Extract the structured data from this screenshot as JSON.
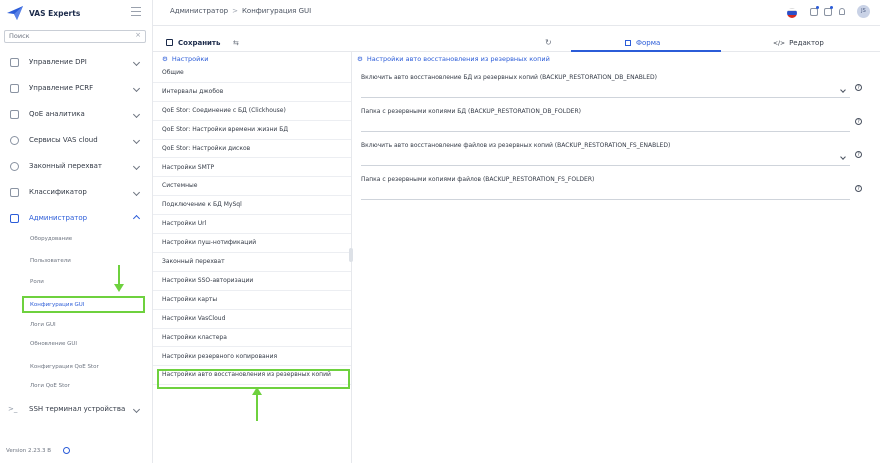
{
  "app": {
    "name": "VAS Experts",
    "version": "Version 2.23.3 B"
  },
  "search": {
    "placeholder": "Поиск"
  },
  "nav": [
    {
      "label": "Управление DPI",
      "icon": "dpi-icon"
    },
    {
      "label": "Управление PCRF",
      "icon": "pcrf-icon"
    },
    {
      "label": "QoE аналитика",
      "icon": "qoe-icon"
    },
    {
      "label": "Сервисы VAS cloud",
      "icon": "cloud-icon"
    },
    {
      "label": "Законный перехват",
      "icon": "intercept-icon"
    },
    {
      "label": "Классификатор",
      "icon": "classifier-icon"
    },
    {
      "label": "Администратор",
      "icon": "admin-icon"
    },
    {
      "label": "SSH терминал устройства",
      "icon": "terminal-icon"
    }
  ],
  "admin_sub": [
    "Оборудование",
    "Пользователи",
    "Роли",
    "Конфигурация GUI",
    "Логи GUI",
    "Обновление GUI",
    "Конфигурация QoE Stor",
    "Логи QoE Stor"
  ],
  "breadcrumb": {
    "root": "Администратор",
    "sep": ">",
    "current": "Конфигурация GUI"
  },
  "toolbar": {
    "save_label": "Сохранить",
    "tab_form": "Форма",
    "tab_editor": "Редактор"
  },
  "settings": {
    "heading": "Настройки",
    "items": [
      "Общие",
      "Интервалы джобов",
      "QoE Stor: Соединение с БД (Clickhouse)",
      "QoE Stor: Настройки времени жизни БД",
      "QoE Stor: Настройки дисков",
      "Настройки SMTP",
      "Системные",
      "Подключение к БД MySql",
      "Настройки Url",
      "Настройки пуш-нотификаций",
      "Законный перехват",
      "Настройки SSO-авторизации",
      "Настройки карты",
      "Настройки VasCloud",
      "Настройки кластера",
      "Настройки резервного копирования",
      "Настройки авто восстановления из резервных копий"
    ]
  },
  "form": {
    "heading": "Настройки авто восстановления из резервных копий",
    "fields": [
      {
        "label": "Включить авто восстановление БД из резервных копий (BACKUP_RESTORATION_DB_ENABLED)",
        "type": "select"
      },
      {
        "label": "Папка с резервными копиями БД (BACKUP_RESTORATION_DB_FOLDER)",
        "type": "text"
      },
      {
        "label": "Включить авто восстановление файлов из резервных копий (BACKUP_RESTORATION_FS_ENABLED)",
        "type": "select"
      },
      {
        "label": "Папка с резервными копиями файлов (BACKUP_RESTORATION_FS_FOLDER)",
        "type": "text"
      }
    ]
  },
  "user": {
    "initials": "JS"
  },
  "colors": {
    "accent": "#2b5cd8",
    "highlight": "#6ed13e"
  }
}
